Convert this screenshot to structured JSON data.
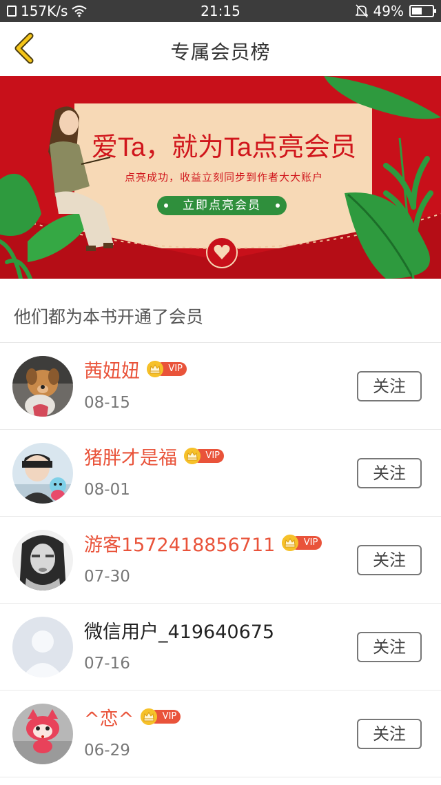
{
  "status_bar": {
    "speed": "157K/s",
    "time": "21:15",
    "battery": "49%",
    "battery_level": 0.49
  },
  "header": {
    "title": "专属会员榜",
    "back_icon": "chevron-left-icon"
  },
  "banner": {
    "headline": "爱Ta，就为Ta点亮会员",
    "subline": "点亮成功，收益立刻同步到作者大大账户",
    "cta_label": "立即点亮会员",
    "colors": {
      "background": "#c8101a",
      "card": "#f7d9b6",
      "cta": "#2f8f3c"
    }
  },
  "section": {
    "title": "他们都为本书开通了会员"
  },
  "vip_label": "VIP",
  "follow_label": "关注",
  "members": [
    {
      "name": "茜妞妞",
      "date": "08-15",
      "vip": true,
      "avatar": "puppy-photo"
    },
    {
      "name": "猪胖才是福",
      "date": "08-01",
      "vip": true,
      "avatar": "boy-photo"
    },
    {
      "name": "游客1572418856711",
      "date": "07-30",
      "vip": true,
      "avatar": "girl-photo"
    },
    {
      "name": "微信用户_419640675",
      "date": "07-16",
      "vip": false,
      "avatar": "default-user"
    },
    {
      "name": "^恋^",
      "date": "06-29",
      "vip": true,
      "avatar": "cartoon-fox"
    }
  ],
  "colors": {
    "vip_name": "#e9533a",
    "vip_badge": "#e9533a",
    "crown": "#f6c12a"
  }
}
